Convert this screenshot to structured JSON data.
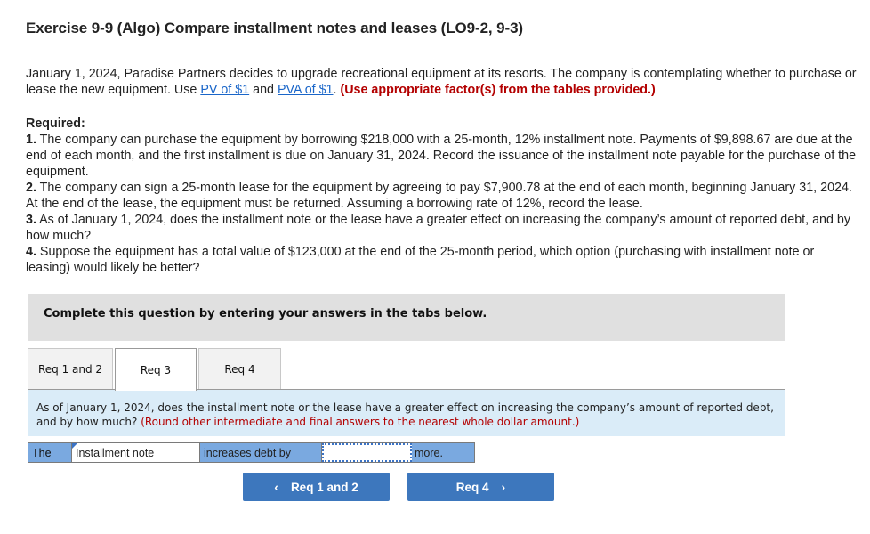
{
  "title": "Exercise 9-9 (Algo) Compare installment notes and leases (LO9-2, 9-3)",
  "intro": {
    "text_before": "January 1, 2024, Paradise Partners decides to upgrade recreational equipment at its resorts. The company is contemplating whether to purchase or lease the new equipment. Use ",
    "link_pv": "PV of $1",
    "text_and": " and ",
    "link_pva": "PVA of $1",
    "text_period": ". ",
    "instruction": "(Use appropriate factor(s) from the tables provided.)"
  },
  "required": {
    "heading": "Required:",
    "items": [
      {
        "num": "1.",
        "text": " The company can purchase the equipment by borrowing $218,000 with a 25-month, 12% installment note. Payments of $9,898.67 are due at the end of each month, and the first installment is due on January 31, 2024. Record the issuance of the installment note payable for the purchase of the equipment."
      },
      {
        "num": "2.",
        "text": " The company can sign a 25-month lease for the equipment by agreeing to pay $7,900.78 at the end of each month, beginning January 31, 2024. At the end of the lease, the equipment must be returned. Assuming a borrowing rate of 12%, record the lease."
      },
      {
        "num": "3.",
        "text": " As of January 1, 2024, does the installment note or the lease have a greater effect on increasing the company’s amount of reported debt, and by how much?"
      },
      {
        "num": "4.",
        "text": " Suppose the equipment has a total value of $123,000 at the end of the 25-month period, which option (purchasing with installment note or leasing) would likely be better?"
      }
    ]
  },
  "instruction_box": "Complete this question by entering your answers in the tabs below.",
  "tabs": [
    {
      "label": "Req 1 and 2",
      "active": false
    },
    {
      "label": "Req 3",
      "active": true
    },
    {
      "label": "Req 4",
      "active": false
    }
  ],
  "panel": {
    "question": "As of January 1, 2024, does the installment note or the lease have a greater effect on increasing the company’s amount of reported debt, and by how much? ",
    "note": "(Round other intermediate and final answers to the nearest whole dollar amount.)"
  },
  "answer_row": {
    "prefix": "The",
    "selected_option": "Installment note",
    "middle": "increases debt by",
    "amount_value": "",
    "suffix": "more."
  },
  "nav": {
    "prev_label": "Req 1 and 2",
    "next_label": "Req 4",
    "prev_icon": "‹",
    "next_icon": "›"
  }
}
